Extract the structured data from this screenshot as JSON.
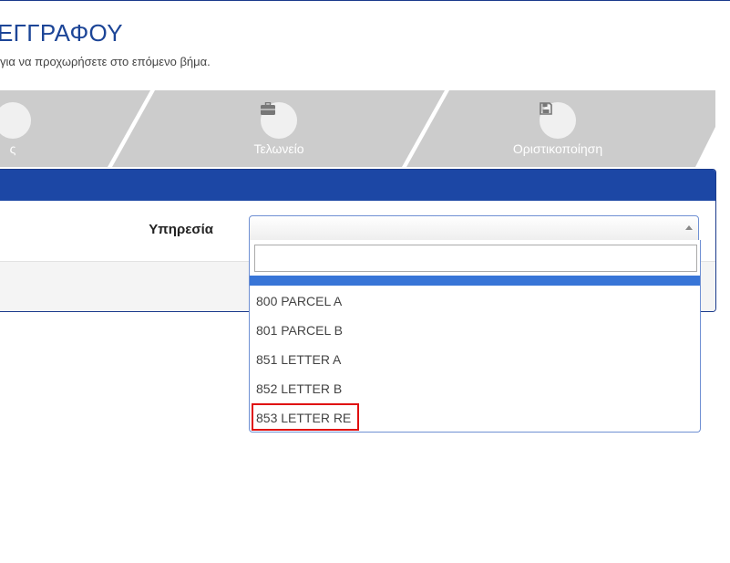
{
  "header": {
    "title": "ΕΓΓΡΑΦΟΥ",
    "subtitle": "για να προχωρήσετε στο επόμενο βήμα."
  },
  "stepper": {
    "steps": [
      {
        "label": "ς",
        "icon": "step-icon",
        "state": "inactive"
      },
      {
        "label": "Τελωνείο",
        "icon": "briefcase-icon",
        "state": "inactive"
      },
      {
        "label": "Οριστικοποίηση",
        "icon": "save-floppy-icon",
        "state": "inactive"
      }
    ]
  },
  "form": {
    "service_label": "Υπηρεσία",
    "service_value": "",
    "search_value": "",
    "options": [
      "800 PARCEL A",
      "801 PARCEL B",
      "851 LETTER A",
      "852 LETTER B",
      "853 LETTER RE"
    ],
    "marked_option": "853 LETTER RE"
  },
  "colors": {
    "accent": "#1c47a5",
    "title": "#1c4597",
    "step_background": "#cccccc",
    "highlight": "#3875d7",
    "marker": "#e01010"
  }
}
